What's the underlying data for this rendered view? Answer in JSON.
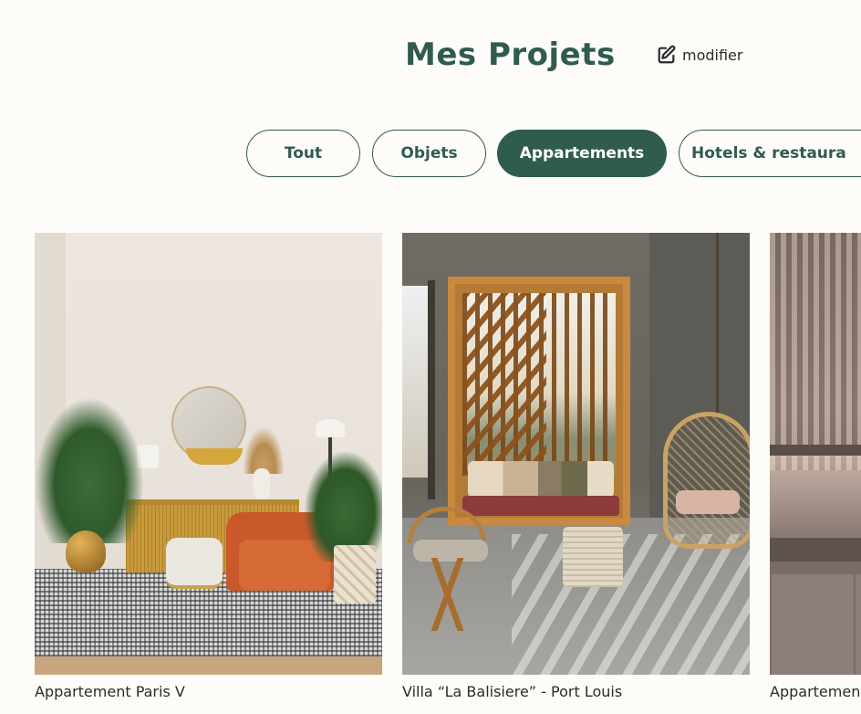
{
  "header": {
    "title": "Mes Projets",
    "edit_label": "modifier",
    "edit_icon": "edit-icon"
  },
  "filters": [
    {
      "label": "Tout",
      "active": false
    },
    {
      "label": "Objets",
      "active": false
    },
    {
      "label": "Appartements",
      "active": true
    },
    {
      "label": "Hotels & restaura",
      "active": false
    }
  ],
  "projects": [
    {
      "caption": "Appartement Paris V"
    },
    {
      "caption": "Villa “La Balisiere” - Port Louis"
    },
    {
      "caption": "Appartemen"
    }
  ],
  "colors": {
    "accent": "#2f5c4f",
    "background": "#fdfcf8",
    "text": "#2b2b2b"
  }
}
